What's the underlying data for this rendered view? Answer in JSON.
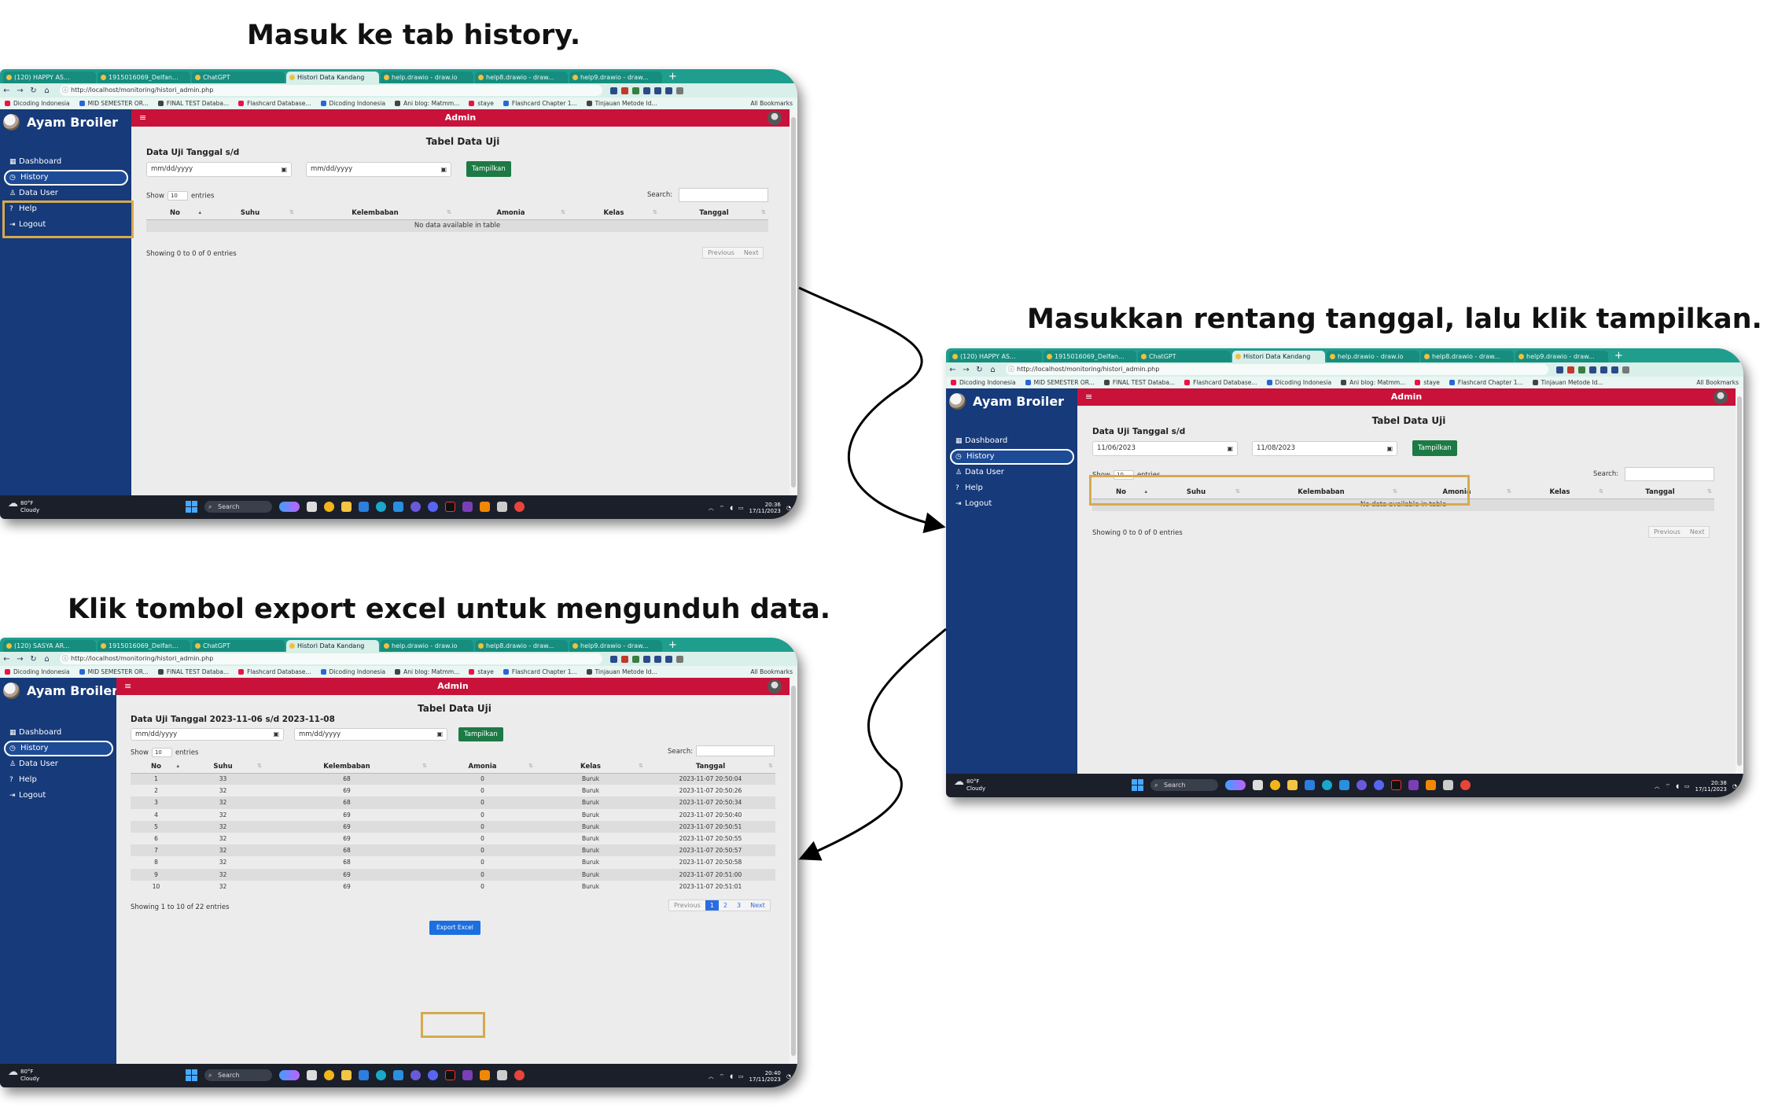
{
  "captions": {
    "step1": "Masuk ke tab history.",
    "step2": "Masukkan rentang tanggal, lalu klik tampilkan.",
    "step3": "Klik tombol export excel untuk mengunduh data."
  },
  "browser": {
    "tabs_top": [
      "(120) HAPPY AS...",
      "1915016069_Delfan...",
      "ChatGPT",
      "Histori Data Kandang",
      "help.drawio - draw.io",
      "help8.drawio - draw...",
      "help9.drawio - draw..."
    ],
    "tabs_bottom": [
      "(120) SASYA AR...",
      "1915016069_Delfan...",
      "ChatGPT",
      "Histori Data Kandang",
      "help.drawio - draw.io",
      "help8.drawio - draw...",
      "help9.drawio - draw..."
    ],
    "active_tab": "Histori Data Kandang",
    "new_tab": "+",
    "url": "http://localhost/monitoring/histori_admin.php",
    "bookmarks": [
      "Dicoding Indonesia",
      "MID SEMESTER OR...",
      "FINAL TEST Databa...",
      "Flashcard Database...",
      "Dicoding Indonesia",
      "Ani blog: Matmm...",
      "staye",
      "Flashcard Chapter 1...",
      "Tinjauan Metode Id..."
    ],
    "all_bookmarks": "All Bookmarks"
  },
  "app": {
    "brand": "Ayam Broiler",
    "topbar_title": "Admin",
    "menu_icon": "≡",
    "menu": [
      {
        "label": "Dashboard",
        "icon": "▦"
      },
      {
        "label": "History",
        "icon": "◷"
      },
      {
        "label": "Data User",
        "icon": "♙"
      },
      {
        "label": "Help",
        "icon": "?"
      },
      {
        "label": "Logout",
        "icon": "⇥"
      }
    ],
    "page_title": "Tabel Data Uji",
    "range_title_empty": "Data Uji Tanggal s/d",
    "range_title_filled": "Data Uji Tanggal 2023-11-06 s/d 2023-11-08",
    "date_placeholder": "mm/dd/yyyy",
    "date_start_value": "11/06/2023",
    "date_end_value": "11/08/2023",
    "show_button": "Tampilkan",
    "show_label": "Show",
    "entries_select": "10",
    "entries_label": "entries",
    "search_label": "Search:",
    "columns": [
      "No",
      "Suhu",
      "Kelembaban",
      "Amonia",
      "Kelas",
      "Tanggal"
    ],
    "empty_message": "No data available in table",
    "info_empty": "Showing 0 to 0 of 0 entries",
    "info_filled": "Showing 1 to 10 of 22 entries",
    "pager_prev": "Previous",
    "pager_next": "Next",
    "pager_pages": [
      "1",
      "2",
      "3"
    ],
    "export_button": "Export Excel",
    "rows": [
      [
        "1",
        "33",
        "68",
        "0",
        "Buruk",
        "2023-11-07 20:50:04"
      ],
      [
        "2",
        "32",
        "69",
        "0",
        "Buruk",
        "2023-11-07 20:50:26"
      ],
      [
        "3",
        "32",
        "68",
        "0",
        "Buruk",
        "2023-11-07 20:50:34"
      ],
      [
        "4",
        "32",
        "69",
        "0",
        "Buruk",
        "2023-11-07 20:50:40"
      ],
      [
        "5",
        "32",
        "69",
        "0",
        "Buruk",
        "2023-11-07 20:50:51"
      ],
      [
        "6",
        "32",
        "69",
        "0",
        "Buruk",
        "2023-11-07 20:50:55"
      ],
      [
        "7",
        "32",
        "68",
        "0",
        "Buruk",
        "2023-11-07 20:50:57"
      ],
      [
        "8",
        "32",
        "68",
        "0",
        "Buruk",
        "2023-11-07 20:50:58"
      ],
      [
        "9",
        "32",
        "69",
        "0",
        "Buruk",
        "2023-11-07 20:51:00"
      ],
      [
        "10",
        "32",
        "69",
        "0",
        "Buruk",
        "2023-11-07 20:51:01"
      ]
    ]
  },
  "taskbar": {
    "weather_temp": "80°F",
    "weather_desc": "Cloudy",
    "search": "Search",
    "date": "17/11/2023",
    "time_shot1": "20:36",
    "time_shot2": "20:38",
    "time_shot3": "20:40"
  },
  "colors": {
    "sidebar": "#163a7a",
    "topbar": "#c8123a",
    "browser_chrome": "#1f9e8e",
    "show_button": "#1c7a45",
    "export_button": "#1b6fe0",
    "highlight": "#d7a94d"
  }
}
